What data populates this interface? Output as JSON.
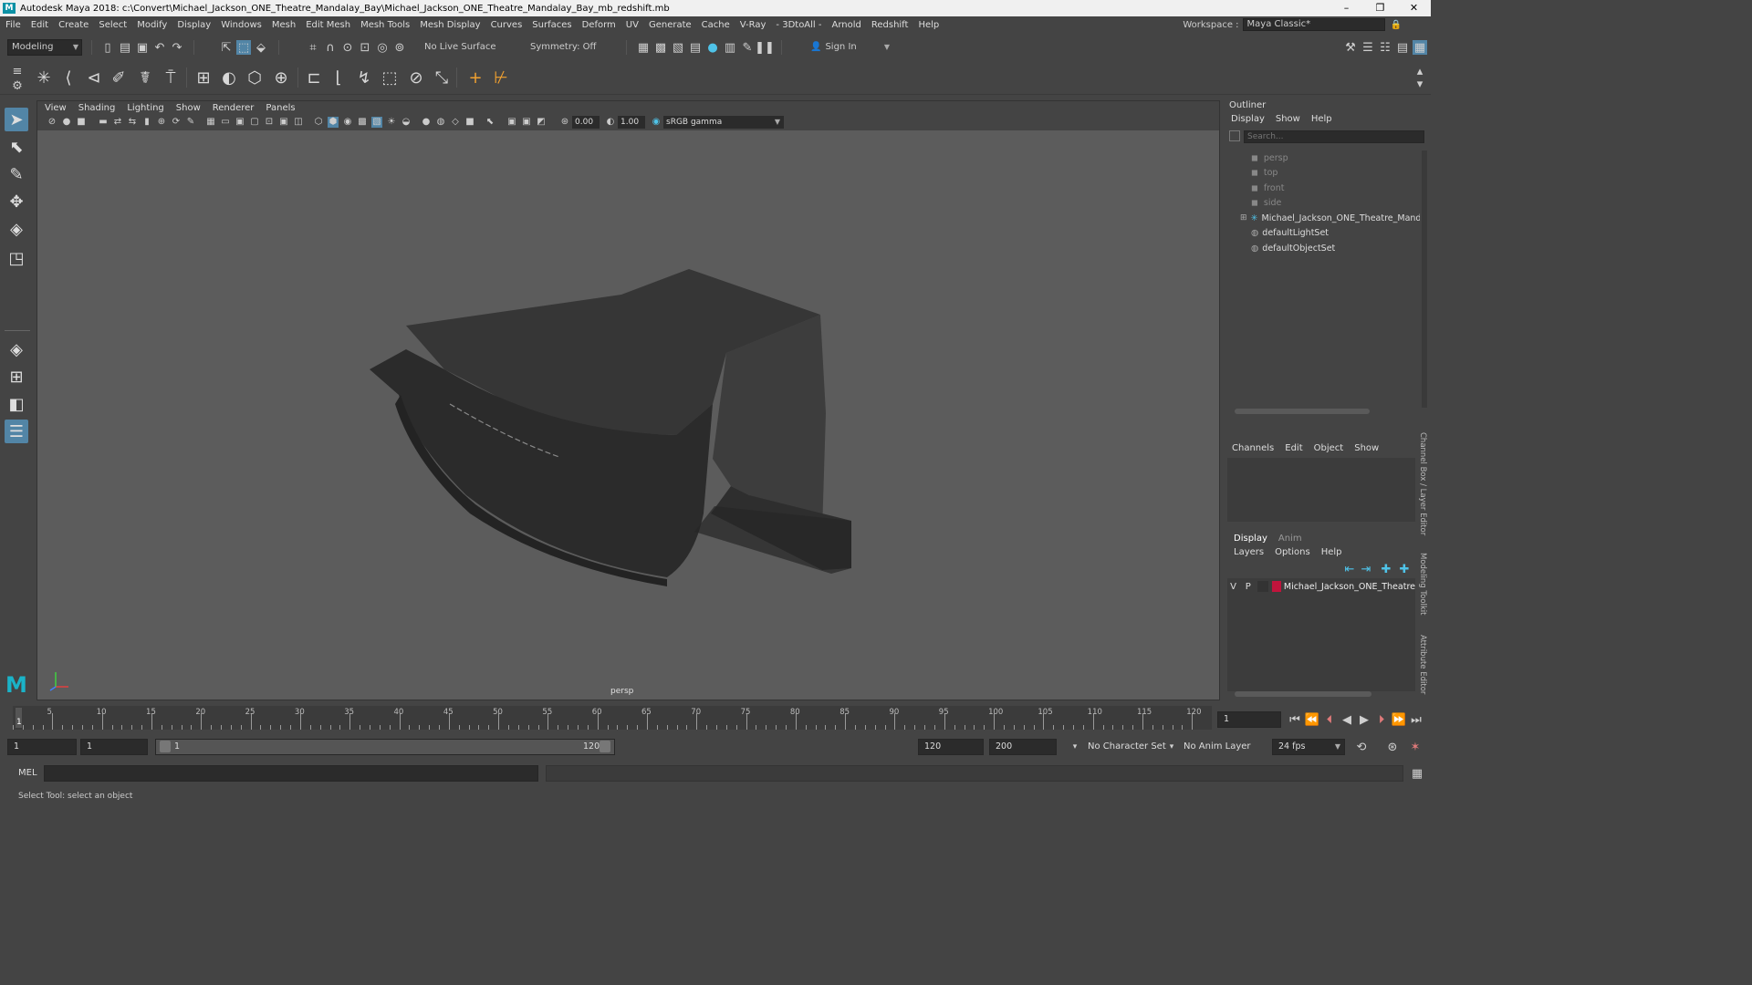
{
  "titlebar": {
    "title": "Autodesk Maya 2018: c:\\Convert\\Michael_Jackson_ONE_Theatre_Mandalay_Bay\\Michael_Jackson_ONE_Theatre_Mandalay_Bay_mb_redshift.mb",
    "minimize": "–",
    "maximize": "❐",
    "close": "✕"
  },
  "menubar": {
    "items": [
      "File",
      "Edit",
      "Create",
      "Select",
      "Modify",
      "Display",
      "Windows",
      "Mesh",
      "Edit Mesh",
      "Mesh Tools",
      "Mesh Display",
      "Curves",
      "Surfaces",
      "Deform",
      "UV",
      "Generate",
      "Cache",
      "V-Ray",
      "- 3DtoAll -",
      "Arnold",
      "Redshift",
      "Help"
    ],
    "workspace_label": "Workspace :",
    "workspace_value": "Maya Classic*"
  },
  "statusline": {
    "mode": "Modeling",
    "live_surface": "No Live Surface",
    "symmetry": "Symmetry: Off",
    "sign_in": "Sign In"
  },
  "viewport": {
    "menu": [
      "View",
      "Shading",
      "Lighting",
      "Show",
      "Renderer",
      "Panels"
    ],
    "exposure": "0.00",
    "gamma": "1.00",
    "color_space": "sRGB gamma",
    "camera": "persp"
  },
  "outliner": {
    "title": "Outliner",
    "menu": [
      "Display",
      "Show",
      "Help"
    ],
    "search_placeholder": "Search...",
    "items": [
      {
        "label": "persp",
        "icon": "camera-icon",
        "dim": true
      },
      {
        "label": "top",
        "icon": "camera-icon",
        "dim": true
      },
      {
        "label": "front",
        "icon": "camera-icon",
        "dim": true
      },
      {
        "label": "side",
        "icon": "camera-icon",
        "dim": true
      },
      {
        "label": "Michael_Jackson_ONE_Theatre_Mandala",
        "icon": "group-icon",
        "dim": false
      },
      {
        "label": "defaultLightSet",
        "icon": "set-icon",
        "dim": false
      },
      {
        "label": "defaultObjectSet",
        "icon": "set-icon",
        "dim": false
      }
    ]
  },
  "channelbox": {
    "menu": [
      "Channels",
      "Edit",
      "Object",
      "Show"
    ]
  },
  "layers": {
    "tabs": [
      "Display",
      "Anim"
    ],
    "menu": [
      "Layers",
      "Options",
      "Help"
    ],
    "layer": {
      "v": "V",
      "p": "P",
      "name": "Michael_Jackson_ONE_Theatre",
      "color": "#c0143c"
    }
  },
  "sidetabs": [
    "Channel Box / Layer Editor",
    "Modeling Toolkit",
    "Attribute Editor"
  ],
  "timeline": {
    "ticks": [
      "5",
      "10",
      "15",
      "20",
      "25",
      "30",
      "35",
      "40",
      "45",
      "50",
      "55",
      "60",
      "65",
      "70",
      "75",
      "80",
      "85",
      "90",
      "95",
      "100",
      "105",
      "110",
      "115",
      "120"
    ],
    "current_marker": "1",
    "current_frame": "1"
  },
  "range": {
    "start": "1",
    "playback_start": "1",
    "slider_start": "1",
    "slider_end": "120",
    "playback_end": "120",
    "end": "200",
    "character_set": "No Character Set",
    "anim_layer": "No Anim Layer",
    "fps": "24 fps"
  },
  "cmdline": {
    "label": "MEL"
  },
  "helpline": {
    "text": "Select Tool: select an object"
  }
}
